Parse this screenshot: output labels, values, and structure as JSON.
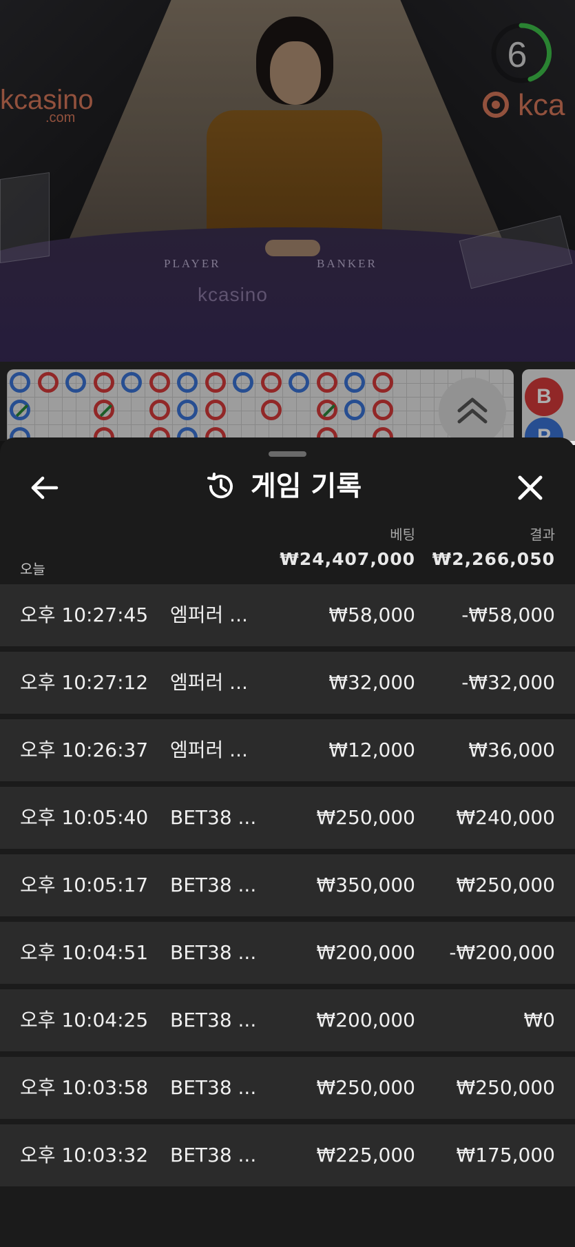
{
  "video": {
    "timer": "6",
    "brand_left": "kcasino",
    "brand_left_sub": ".com",
    "brand_right": "kca",
    "table_player": "PLAYER",
    "table_banker": "BANKER",
    "table_logo": "kcasino"
  },
  "scoreboard": {
    "side_b": "B",
    "side_p": "P"
  },
  "panel": {
    "title": "게임 기록",
    "back_icon": "arrow-left-icon",
    "history_icon": "history-icon",
    "close_icon": "close-icon",
    "col_bet": "베팅",
    "col_result": "결과",
    "today_label": "오늘",
    "total_bet": "₩24,407,000",
    "total_result": "₩2,266,050",
    "rows": [
      {
        "time": "오후 10:27:45",
        "game": "엠퍼러 ...",
        "bet": "₩58,000",
        "result": "-₩58,000"
      },
      {
        "time": "오후 10:27:12",
        "game": "엠퍼러 ...",
        "bet": "₩32,000",
        "result": "-₩32,000"
      },
      {
        "time": "오후 10:26:37",
        "game": "엠퍼러 ...",
        "bet": "₩12,000",
        "result": "₩36,000"
      },
      {
        "time": "오후 10:05:40",
        "game": "BET38 ...",
        "bet": "₩250,000",
        "result": "₩240,000"
      },
      {
        "time": "오후 10:05:17",
        "game": "BET38 ...",
        "bet": "₩350,000",
        "result": "₩250,000"
      },
      {
        "time": "오후 10:04:51",
        "game": "BET38 ...",
        "bet": "₩200,000",
        "result": "-₩200,000"
      },
      {
        "time": "오후 10:04:25",
        "game": "BET38 ...",
        "bet": "₩200,000",
        "result": "₩0"
      },
      {
        "time": "오후 10:03:58",
        "game": "BET38 ...",
        "bet": "₩250,000",
        "result": "₩250,000"
      },
      {
        "time": "오후 10:03:32",
        "game": "BET38 ...",
        "bet": "₩225,000",
        "result": "₩175,000"
      }
    ]
  },
  "colors": {
    "banker": "#d63a3a",
    "player": "#3a74d6",
    "tie": "#2a8a3a",
    "panel_bg": "#1b1b1b",
    "row_bg": "#2b2b2b",
    "timer_ring": "#3fc24a"
  }
}
